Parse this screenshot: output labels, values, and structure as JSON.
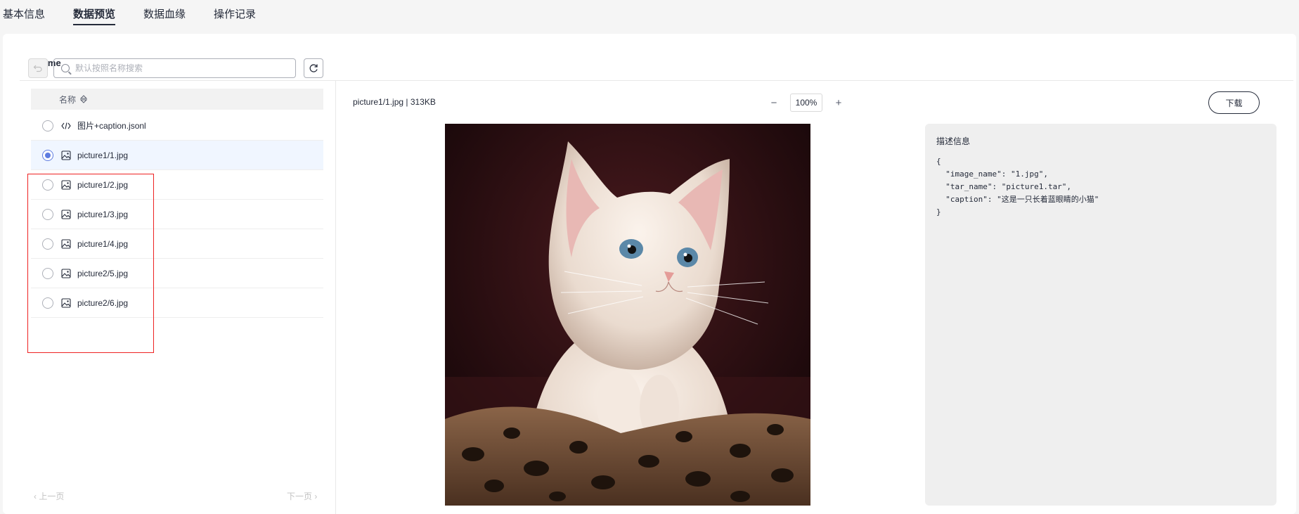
{
  "tabs": [
    {
      "label": "基本信息",
      "active": false
    },
    {
      "label": "数据预览",
      "active": true
    },
    {
      "label": "数据血缘",
      "active": false
    },
    {
      "label": "操作记录",
      "active": false
    }
  ],
  "breadcrumb": "home",
  "search": {
    "placeholder": "默认按照名称搜索",
    "value": ""
  },
  "list": {
    "header": "名称",
    "items": [
      {
        "name": "图片+caption.jsonl",
        "type": "code",
        "selected": false
      },
      {
        "name": "picture1/1.jpg",
        "type": "image",
        "selected": true
      },
      {
        "name": "picture1/2.jpg",
        "type": "image",
        "selected": false
      },
      {
        "name": "picture1/3.jpg",
        "type": "image",
        "selected": false
      },
      {
        "name": "picture1/4.jpg",
        "type": "image",
        "selected": false
      },
      {
        "name": "picture2/5.jpg",
        "type": "image",
        "selected": false
      },
      {
        "name": "picture2/6.jpg",
        "type": "image",
        "selected": false
      }
    ]
  },
  "pager": {
    "prev": "上一页",
    "next": "下一页"
  },
  "preview": {
    "file_info": "picture1/1.jpg | 313KB",
    "zoom": "100%",
    "zoom_out": "−",
    "zoom_in": "+",
    "download": "下载"
  },
  "description": {
    "title": "描述信息",
    "code": "{\n  \"image_name\": \"1.jpg\",\n  \"tar_name\": \"picture1.tar\",\n  \"caption\": \"这是一只长着蓝眼睛的小猫\"\n}"
  },
  "colors": {
    "accent": "#5e7ce0",
    "highlight_box": "#ee2222",
    "selected_row": "#f0f6ff"
  }
}
